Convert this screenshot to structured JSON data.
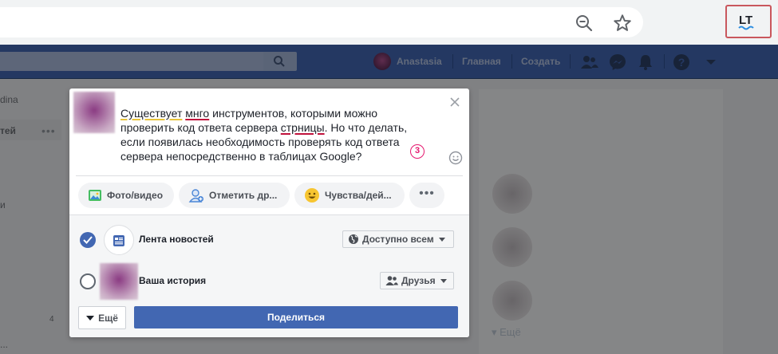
{
  "browser": {
    "icons": [
      "zoom-out-icon",
      "bookmark-star-icon",
      "extension-lt-icon"
    ]
  },
  "fb_header": {
    "user_name": "Anastasia",
    "nav": [
      "Главная",
      "Создать"
    ],
    "icons": [
      "search-icon",
      "friends-icon",
      "messenger-icon",
      "notifications-icon",
      "help-icon",
      "menu-caret-icon"
    ]
  },
  "left_sidebar": {
    "items": [
      "dina",
      "тей",
      "и"
    ],
    "count": "4"
  },
  "right_panel": {
    "more_label": "Ещё"
  },
  "composer": {
    "text_parts": {
      "p1": "Существует",
      "p2": "мнго",
      "p3": " инструментов, которыми можно проверить код ответа сервера ",
      "p4": "стрницы",
      "p5": ". Но что делать, если появилась необходимость проверять код ответа сервера непосредственно в таблицах Google?"
    },
    "lt_badge": "3",
    "actions": [
      "Фото/видео",
      "Отметить др...",
      "Чувства/дей..."
    ],
    "feed_label": "Лента новостей",
    "feed_audience": "Доступно всем",
    "story_label": "Ваша история",
    "story_audience": "Друзья",
    "more_label": "Ещё",
    "share_label": "Поделиться"
  },
  "colors": {
    "fb_blue": "#4267b2",
    "lt_border": "#c9575d",
    "badge": "#e5186f"
  }
}
